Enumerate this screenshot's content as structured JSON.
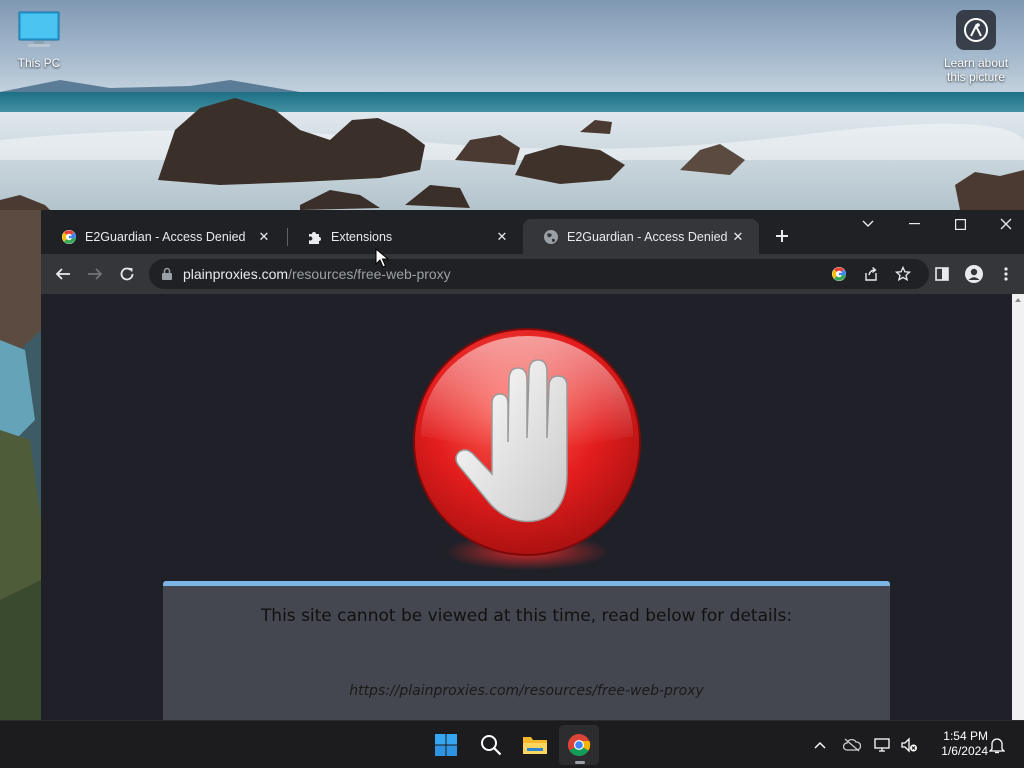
{
  "desktop": {
    "icons": [
      {
        "label": "This PC",
        "icon": "monitor-icon"
      },
      {
        "label": "Learn about this picture",
        "icon": "camera-aperture-icon"
      }
    ]
  },
  "browser": {
    "tabs": [
      {
        "label": "E2Guardian - Access Denied",
        "favicon": "google-icon",
        "active": false
      },
      {
        "label": "Extensions",
        "favicon": "puzzle-icon",
        "active": false
      },
      {
        "label": "E2Guardian - Access Denied",
        "favicon": "globe-icon",
        "active": true
      }
    ],
    "address": {
      "domain": "plainproxies.com",
      "path": "/resources/free-web-proxy"
    },
    "page": {
      "heading": "This site cannot be viewed at this time, read below for details:",
      "blocked_url": "https://plainproxies.com/resources/free-web-proxy"
    }
  },
  "taskbar": {
    "apps": [
      "windows-start-icon",
      "search-icon",
      "file-explorer-icon",
      "chrome-icon"
    ],
    "active_app": "chrome-icon",
    "time": "1:54 PM",
    "date": "1/6/2024"
  },
  "colors": {
    "chrome_dark": "#202124",
    "toolbar": "#35363a",
    "page_bg": "#202128",
    "message_box": "#44474f",
    "message_accent": "#7cb4e6",
    "stop_red": "#d91e1e",
    "taskbar": "#1c1c1e"
  }
}
